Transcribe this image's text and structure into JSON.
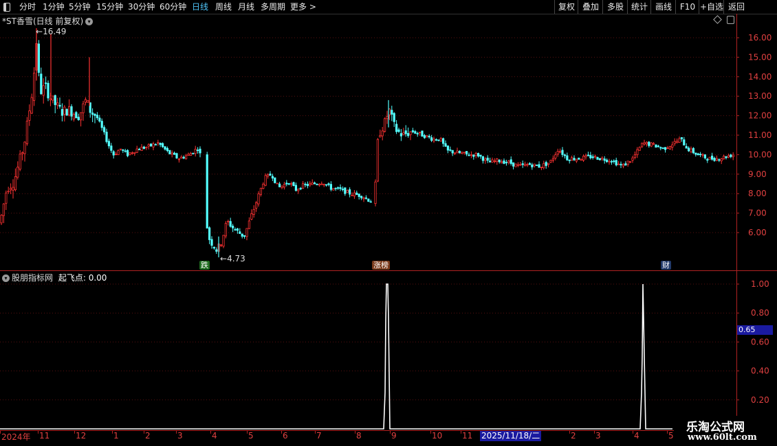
{
  "toolbar": {
    "periods": [
      "分时",
      "1分钟",
      "5分钟",
      "15分钟",
      "30分钟",
      "60分钟",
      "日线",
      "周线",
      "月线",
      "多周期",
      "更多 >"
    ],
    "active_period": "日线",
    "right_buttons": [
      "复权",
      "叠加",
      "多股",
      "统计",
      "画线",
      "F10",
      "+自选",
      "返回"
    ]
  },
  "main_panel": {
    "title": "*ST香雪(日线 前复权)",
    "high_label": "16.49",
    "low_label": "4.73",
    "y_ticks": [
      "16.00",
      "15.00",
      "14.00",
      "13.00",
      "12.00",
      "11.00",
      "10.00",
      "9.00",
      "8.00",
      "7.00",
      "6.00"
    ],
    "events": [
      {
        "label": "跌",
        "color": "#2e8b2e"
      },
      {
        "label": "涨榜",
        "color": "#a0522d"
      },
      {
        "label": "财",
        "color": "#2f4f8f"
      }
    ]
  },
  "indicator_panel": {
    "title": "股朋指标网",
    "series_label": "起飞点: 0.00",
    "y_ticks": [
      "1.00",
      "0.80",
      "0.60",
      "0.40",
      "0.20"
    ],
    "cursor_value": "0.65"
  },
  "bottom_axis": {
    "labels": [
      "2024年",
      "11",
      "12",
      "1",
      "2",
      "3",
      "4",
      "5",
      "6",
      "7",
      "8",
      "9",
      "10",
      "11",
      "1",
      "2",
      "3",
      "4",
      "5"
    ],
    "cursor_date": "2025/11/18/二"
  },
  "watermark": {
    "line1": "乐淘公式网",
    "line2": "www.60lt.com"
  },
  "colors": {
    "up": "#ff3232",
    "down": "#54ffff",
    "axis": "#b22222",
    "grid": "#5a1010"
  },
  "chart_data": [
    {
      "type": "candlestick",
      "title": "*ST香雪(日线 前复权)",
      "ylim": [
        4.5,
        16.8
      ],
      "y_ticks": [
        16,
        15,
        14,
        13,
        12,
        11,
        10,
        9,
        8,
        7,
        6
      ],
      "annotations": [
        {
          "text": "16.49",
          "type": "high"
        },
        {
          "text": "4.73",
          "type": "low"
        }
      ],
      "close_path": [
        {
          "x": "2024-10",
          "y": 6.5
        },
        {
          "x": "2024-10",
          "y": 8.5
        },
        {
          "x": "2024-10",
          "y": 11.5
        },
        {
          "x": "2024-10",
          "y": 15.5
        },
        {
          "x": "2024-11",
          "y": 13.5
        },
        {
          "x": "2024-11",
          "y": 12.5
        },
        {
          "x": "2024-12",
          "y": 12.0
        },
        {
          "x": "2024-12",
          "y": 12.5
        },
        {
          "x": "2025-01",
          "y": 10.5
        },
        {
          "x": "2025-01",
          "y": 10.0
        },
        {
          "x": "2025-02",
          "y": 10.0
        },
        {
          "x": "2025-03",
          "y": 10.2
        },
        {
          "x": "2025-04",
          "y": 6.5
        },
        {
          "x": "2025-04",
          "y": 5.0
        },
        {
          "x": "2025-05",
          "y": 5.8
        },
        {
          "x": "2025-05",
          "y": 7.5
        },
        {
          "x": "2025-06",
          "y": 8.5
        },
        {
          "x": "2025-07",
          "y": 8.3
        },
        {
          "x": "2025-08",
          "y": 8.0
        },
        {
          "x": "2025-08",
          "y": 7.6
        },
        {
          "x": "2025-09",
          "y": 11.5
        },
        {
          "x": "2025-09",
          "y": 11.0
        },
        {
          "x": "2025-10",
          "y": 10.0
        },
        {
          "x": "2025-11",
          "y": 9.8
        },
        {
          "x": "2025-12",
          "y": 9.5
        },
        {
          "x": "2026-01",
          "y": 9.8
        },
        {
          "x": "2026-02",
          "y": 9.5
        },
        {
          "x": "2026-03",
          "y": 10.5
        },
        {
          "x": "2026-04",
          "y": 10.8
        },
        {
          "x": "2026-04",
          "y": 10.0
        },
        {
          "x": "2026-05",
          "y": 9.6
        }
      ]
    },
    {
      "type": "line",
      "title": "股朋指标网",
      "series": [
        {
          "name": "起飞点",
          "spikes_at": [
            "2025-09",
            "2026-04"
          ],
          "spike_value": 1.0,
          "base_value": 0.0
        }
      ],
      "ylim": [
        0,
        1.05
      ],
      "y_ticks": [
        1.0,
        0.8,
        0.6,
        0.4,
        0.2
      ]
    }
  ]
}
